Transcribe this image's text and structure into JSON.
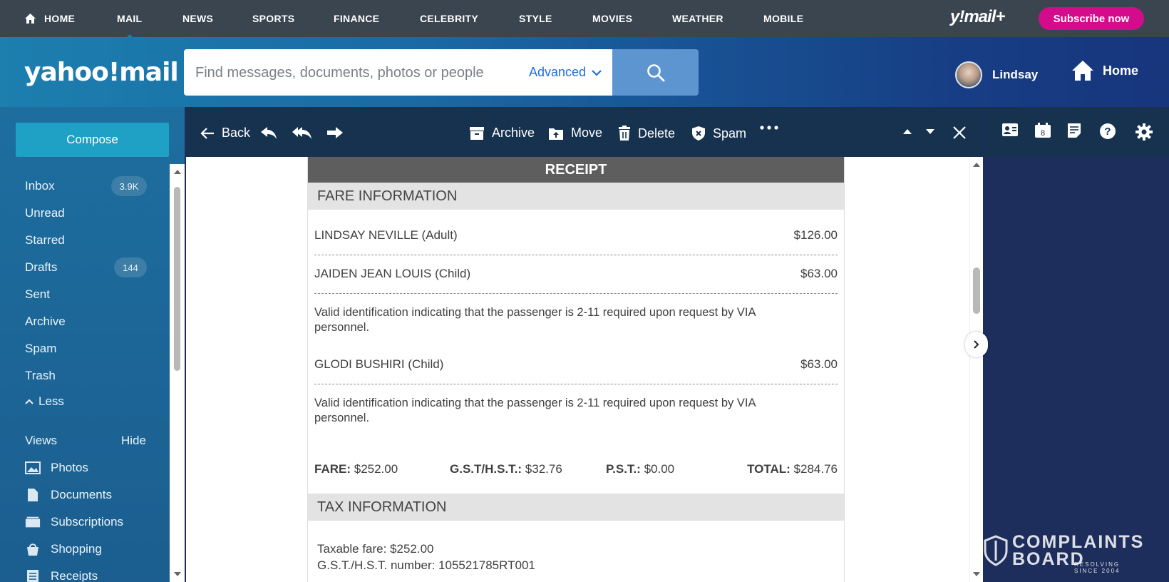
{
  "topnav": {
    "items": [
      "HOME",
      "MAIL",
      "NEWS",
      "SPORTS",
      "FINANCE",
      "CELEBRITY",
      "STYLE",
      "MOVIES",
      "WEATHER",
      "MOBILE"
    ],
    "brand": "y!mail+",
    "subscribe_label": "Subscribe now"
  },
  "header": {
    "logo": "yahoo!mail",
    "search_placeholder": "Find messages, documents, photos or people",
    "advanced_label": "Advanced",
    "user_name": "Lindsay",
    "home_label": "Home"
  },
  "sidebar": {
    "compose_label": "Compose",
    "folders": [
      {
        "label": "Inbox",
        "badge": "3.9K"
      },
      {
        "label": "Unread"
      },
      {
        "label": "Starred"
      },
      {
        "label": "Drafts",
        "badge": "144"
      },
      {
        "label": "Sent"
      },
      {
        "label": "Archive"
      },
      {
        "label": "Spam"
      },
      {
        "label": "Trash"
      }
    ],
    "less_label": "Less",
    "views_label": "Views",
    "hide_label": "Hide",
    "views": [
      {
        "label": "Photos",
        "icon": "photo-icon"
      },
      {
        "label": "Documents",
        "icon": "document-icon"
      },
      {
        "label": "Subscriptions",
        "icon": "subscriptions-icon"
      },
      {
        "label": "Shopping",
        "icon": "shopping-bag-icon"
      },
      {
        "label": "Receipts",
        "icon": "receipt-icon"
      }
    ]
  },
  "toolbar": {
    "back_label": "Back",
    "archive_label": "Archive",
    "move_label": "Move",
    "delete_label": "Delete",
    "spam_label": "Spam",
    "calendar_day": "8"
  },
  "receipt": {
    "title": "RECEIPT",
    "fare_section": "FARE INFORMATION",
    "passengers": [
      {
        "name": "LINDSAY NEVILLE (Adult)",
        "amount": "$126.00"
      },
      {
        "name": "JAIDEN JEAN LOUIS (Child)",
        "amount": "$63.00"
      },
      {
        "name": "GLODI BUSHIRI (Child)",
        "amount": "$63.00"
      }
    ],
    "child_note_line1": "Valid identification indicating that the passenger is 2-11 required upon request by VIA",
    "child_note_line2": "personnel.",
    "totals": {
      "fare_label": "FARE:",
      "fare_value": "$252.00",
      "gst_label": "G.S.T/H.S.T.:",
      "gst_value": "$32.76",
      "pst_label": "P.S.T.:",
      "pst_value": "$0.00",
      "total_label": "TOTAL:",
      "total_value": "$284.76"
    },
    "tax_section": "TAX INFORMATION",
    "taxable_fare": "Taxable fare: $252.00",
    "gst_number": "G.S.T./H.S.T. number: 105521785RT001"
  },
  "watermark": {
    "line1": "COMPLAINTS",
    "line2": "BOARD",
    "tagline1": "RESOLVING",
    "tagline2": "SINCE 2004"
  },
  "colors": {
    "subscribe": "#d40c8c",
    "toolbar": "#16324f",
    "sidebar": "#1d6e9f",
    "search_button": "#5d95d0"
  }
}
